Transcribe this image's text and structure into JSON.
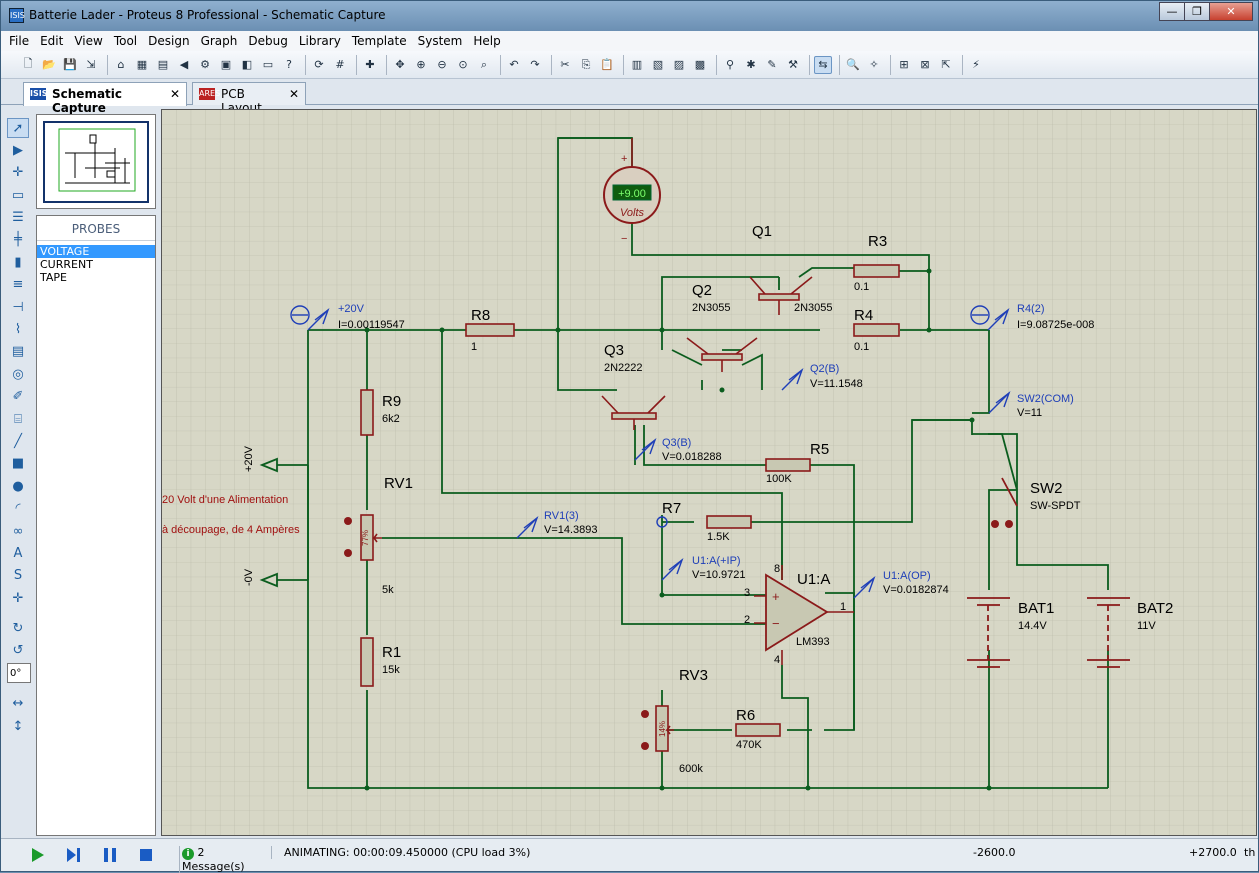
{
  "window": {
    "title": "Batterie Lader - Proteus 8 Professional - Schematic Capture",
    "buttons": [
      "—",
      "❐",
      "✕"
    ]
  },
  "menu": [
    "File",
    "Edit",
    "View",
    "Tool",
    "Design",
    "Graph",
    "Debug",
    "Library",
    "Template",
    "System",
    "Help"
  ],
  "tabs": [
    {
      "label": "Schematic Capture",
      "active": true
    },
    {
      "label": "PCB Layout",
      "active": false
    }
  ],
  "left_tools": {
    "rotation_value": "0°"
  },
  "probes": {
    "header": "PROBES",
    "items": [
      "VOLTAGE",
      "CURRENT",
      "TAPE"
    ],
    "selected": "VOLTAGE"
  },
  "schematic": {
    "voltmeter": {
      "value": "+9.00",
      "unit": "Volts"
    },
    "labels": {
      "q1": "Q1",
      "q2": "Q2",
      "q2_type": "2N3055",
      "q1_type": "2N3055",
      "q3": "Q3",
      "q3_type": "2N2222",
      "r3": "R3",
      "r3_val": "0.1",
      "r4": "R4",
      "r4_val": "0.1",
      "r8": "R8",
      "r8_val": "1",
      "r9": "R9",
      "r9_val": "6k2",
      "rv1": "RV1",
      "rv1_val": "5k",
      "rv1_pct": "77%",
      "r1": "R1",
      "r1_val": "15k",
      "r5": "R5",
      "r5_val": "100K",
      "r7": "R7",
      "r7_val": "1.5K",
      "r6": "R6",
      "r6_val": "470K",
      "rv3": "RV3",
      "rv3_val": "600k",
      "rv3_pct": "14%",
      "u1": "U1:A",
      "u1_type": "LM393",
      "pin3": "3",
      "pin2": "2",
      "pin1": "1",
      "pin8": "8",
      "pin4": "4",
      "sw2": "SW2",
      "sw2_type": "SW-SPDT",
      "bat1": "BAT1",
      "bat1_val": "14.4V",
      "bat2": "BAT2",
      "bat2_val": "11V",
      "plus20": "+20V",
      "minus0": "-0V",
      "note1": "20 Volt d'une Alimentation",
      "note2": "à découpage, de 4 Ampères"
    },
    "probes": {
      "p20_name": "+20V",
      "p20_val": "I=0.00119547",
      "r4_name": "R4(2)",
      "r4_val": "I=9.08725e-008",
      "q2b_name": "Q2(B)",
      "q2b_val": "V=11.1548",
      "sw2_name": "SW2(COM)",
      "sw2_val": "V=11",
      "q3b_name": "Q3(B)",
      "q3b_val": "V=0.018288",
      "rv1_name": "RV1(3)",
      "rv1_val": "V=14.3893",
      "u1ip_name": "U1:A(+IP)",
      "u1ip_val": "V=10.9721",
      "u1op_name": "U1:A(OP)",
      "u1op_val": "V=0.0182874"
    }
  },
  "status": {
    "messages": "2 Message(s)",
    "animating": "ANIMATING: 00:00:09.450000 (CPU load 3%)",
    "coord_x": "-2600.0",
    "coord_y": "+2700.0",
    "unit": "th"
  },
  "colors": {
    "wire": "#0b5d1e",
    "component": "#8b1a1a",
    "probe": "#1f3fb8",
    "grid": "#bcbcaa",
    "canvas": "#d7d7c6",
    "note": "#a01010"
  }
}
